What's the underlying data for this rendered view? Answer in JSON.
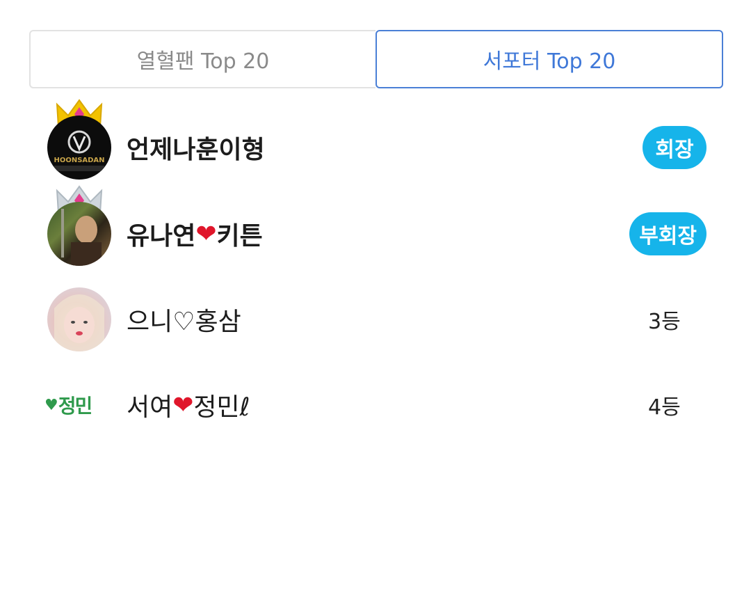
{
  "tabs": [
    {
      "label": "열혈팬 Top 20",
      "active": false
    },
    {
      "label": "서포터 Top 20",
      "active": true
    }
  ],
  "supporters": [
    {
      "name": "언제나훈이형",
      "badge": "회장",
      "avatar_text": "HOONSADAN",
      "crown": "gold"
    },
    {
      "name_pre": "유나연",
      "name_heart": "❤",
      "name_post": "키튼",
      "badge": "부회장",
      "crown": "silver"
    },
    {
      "name": "으니♡홍삼",
      "rank": "3등"
    },
    {
      "name_pre": "서여",
      "name_heart": "❤",
      "name_post": "정민ℓ",
      "rank": "4등",
      "avatar_text": "정민"
    }
  ],
  "colors": {
    "accent": "#3f78d8",
    "badge": "#16b4ea",
    "gold_crown": "#f2c200",
    "silver_crown": "#cfd6dc"
  }
}
